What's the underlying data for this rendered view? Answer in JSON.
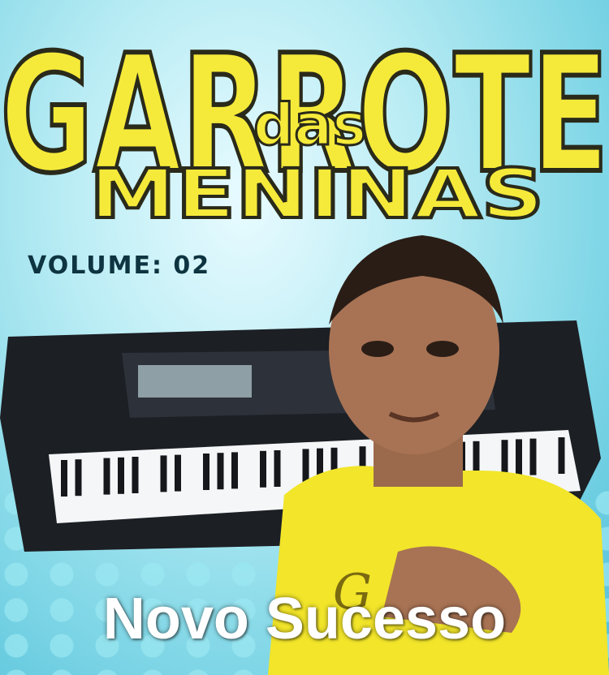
{
  "cover": {
    "title_main": "GARROTE",
    "title_mid": "das",
    "title_sub": "MENINAS",
    "volume": "VOLUME: 02",
    "shirt_mark": "G"
  },
  "caption": "Novo Sucesso",
  "colors": {
    "title_yellow": "#f5ea3a",
    "title_outline": "#2a2a1a",
    "background": "#7fd6e6",
    "shirt": "#f2e52a",
    "caption": "#ffffff"
  }
}
